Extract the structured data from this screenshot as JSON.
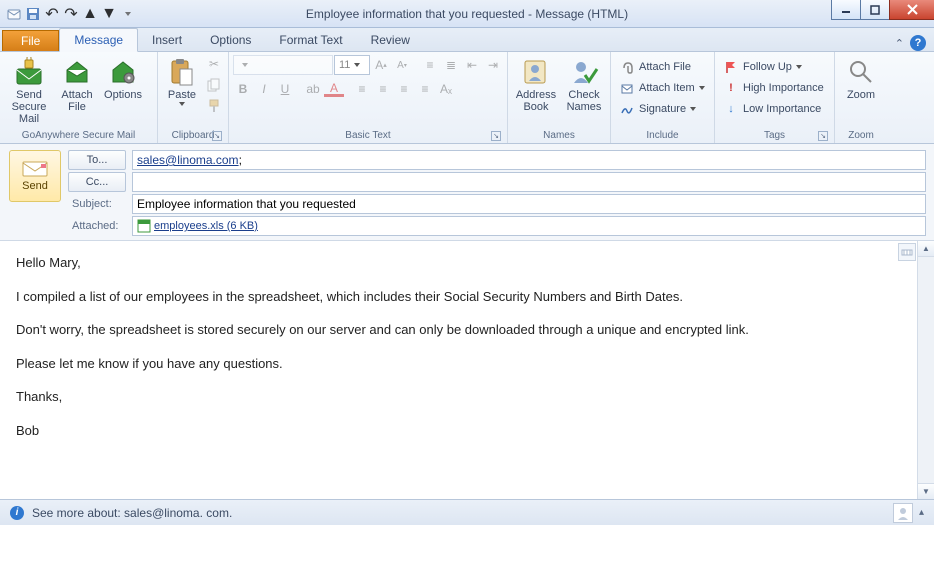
{
  "window": {
    "title": "Employee information that you requested  -  Message (HTML)"
  },
  "tabs": {
    "file": "File",
    "message": "Message",
    "insert": "Insert",
    "options": "Options",
    "format_text": "Format Text",
    "review": "Review"
  },
  "ribbon": {
    "goanywhere": {
      "label": "GoAnywhere Secure Mail",
      "send_secure": "Send Secure Mail",
      "attach_file": "Attach File",
      "options": "Options"
    },
    "clipboard": {
      "label": "Clipboard",
      "paste": "Paste"
    },
    "basic_text": {
      "label": "Basic Text",
      "font_size": "11"
    },
    "names": {
      "label": "Names",
      "address_book": "Address Book",
      "check_names": "Check Names"
    },
    "include": {
      "label": "Include",
      "attach_file": "Attach File",
      "attach_item": "Attach Item",
      "signature": "Signature"
    },
    "tags": {
      "label": "Tags",
      "follow_up": "Follow Up",
      "high": "High Importance",
      "low": "Low Importance"
    },
    "zoom": {
      "label": "Zoom",
      "zoom": "Zoom"
    }
  },
  "compose": {
    "send": "Send",
    "to_label": "To...",
    "cc_label": "Cc...",
    "subject_label": "Subject:",
    "attached_label": "Attached:",
    "to_value": "sales@linoma.com",
    "to_suffix": ";",
    "cc_value": "",
    "subject_value": "Employee information that you requested",
    "attachment_name": "employees.xls (6 KB)"
  },
  "body": {
    "p1": "Hello Mary,",
    "p2": "I compiled a list of our employees in the spreadsheet, which includes their Social Security Numbers and Birth Dates.",
    "p3": "Don't worry, the spreadsheet is stored securely on our server and can only be downloaded through a unique and encrypted link.",
    "p4": "Please let me know if you have any questions.",
    "p5": "Thanks,",
    "p6": "Bob"
  },
  "statusbar": {
    "text": "See more about: sales@linoma. com."
  }
}
